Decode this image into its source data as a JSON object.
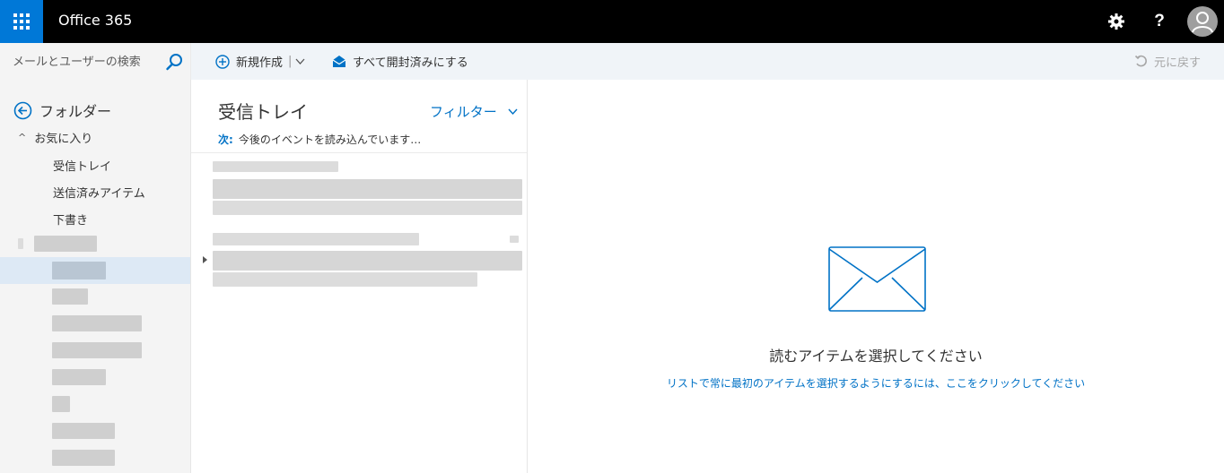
{
  "app": {
    "title": "Office 365"
  },
  "search": {
    "placeholder": "メールとユーザーの検索"
  },
  "toolbar": {
    "new_label": "新規作成",
    "separator": "|",
    "mark_all_read_label": "すべて開封済みにする",
    "undo_label": "元に戻す"
  },
  "folders": {
    "header": "フォルダー",
    "favorites_label": "お気に入り",
    "items": [
      {
        "label": "受信トレイ"
      },
      {
        "label": "送信済みアイテム"
      },
      {
        "label": "下書き"
      }
    ]
  },
  "message_list": {
    "title": "受信トレイ",
    "filter_label": "フィルター",
    "next_label": "次:",
    "next_text": "今後のイベントを読み込んでいます…"
  },
  "reading_pane": {
    "empty_title": "読むアイテムを選択してください",
    "empty_link": "リストで常に最初のアイテムを選択するようにするには、ここをクリックしてください"
  },
  "colors": {
    "accent": "#0078d7",
    "link": "#0072c6",
    "topbar": "#000000"
  }
}
